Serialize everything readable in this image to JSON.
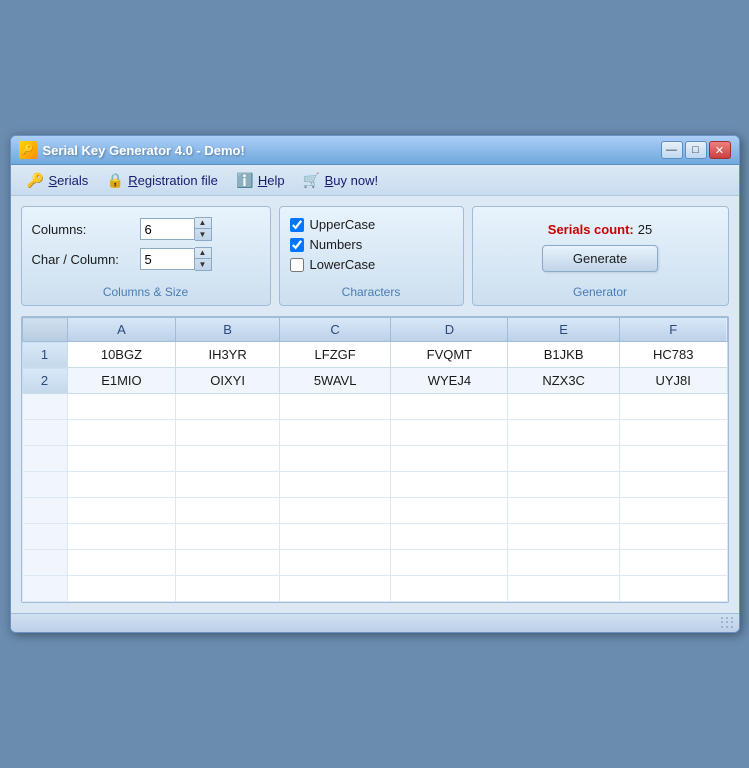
{
  "window": {
    "title": "Serial Key Generator 4.0 - Demo!",
    "icon": "🔑"
  },
  "titleControls": {
    "minimize": "—",
    "maximize": "□",
    "close": "✕"
  },
  "menu": {
    "items": [
      {
        "icon": "🔑",
        "label": "Serials",
        "underline": "S"
      },
      {
        "icon": "🔒",
        "label": "Registration file",
        "underline": "R"
      },
      {
        "icon": "ℹ",
        "label": "Help",
        "underline": "H"
      },
      {
        "icon": "🛒",
        "label": "Buy now!",
        "underline": "B"
      }
    ]
  },
  "columnsPanel": {
    "label": "Columns & Size",
    "fields": [
      {
        "label": "Columns:",
        "value": "6"
      },
      {
        "label": "Char / Column:",
        "value": "5"
      }
    ]
  },
  "charactersPanel": {
    "label": "Characters",
    "checkboxes": [
      {
        "label": "UpperCase",
        "checked": true
      },
      {
        "label": "Numbers",
        "checked": true
      },
      {
        "label": "LowerCase",
        "checked": false
      }
    ]
  },
  "generatorPanel": {
    "label": "Generator",
    "serialsCountLabel": "Serials count:",
    "serialsCountValue": "25",
    "generateBtn": "Generate"
  },
  "table": {
    "headers": [
      "",
      "A",
      "B",
      "C",
      "D",
      "E",
      "F"
    ],
    "rows": [
      {
        "num": "1",
        "cells": [
          "10BGZ",
          "IH3YR",
          "LFZGF",
          "FVQMT",
          "B1JKB",
          "HC783"
        ]
      },
      {
        "num": "2",
        "cells": [
          "E1MIO",
          "OIXYI",
          "5WAVL",
          "WYEJ4",
          "NZX3C",
          "UYJ8I"
        ]
      }
    ]
  }
}
